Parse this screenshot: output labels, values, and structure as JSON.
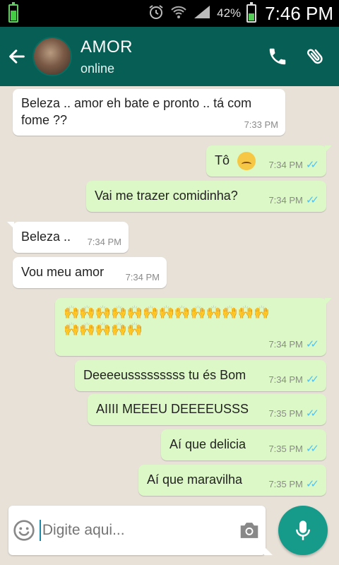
{
  "status_bar": {
    "battery_percent": "42%",
    "time": "7:46 PM",
    "icons": [
      "battery-icon",
      "alarm-icon",
      "wifi-icon",
      "signal-icon",
      "battery-charging-icon"
    ]
  },
  "header": {
    "contact_name": "AMOR",
    "contact_status": "online",
    "icons": [
      "back-arrow-icon",
      "avatar",
      "phone-icon",
      "paperclip-icon"
    ],
    "color": "#075e54"
  },
  "messages": [
    {
      "dir": "in",
      "text_line1": "Beleza .. amor eh bate e pronto .. tá com",
      "text_line2": "fome ??",
      "time": "7:33 PM"
    },
    {
      "dir": "out",
      "text": "Tô",
      "emoji": "worried-face-emoji",
      "time": "7:34 PM"
    },
    {
      "dir": "out",
      "text": "Vai me trazer comidinha?",
      "time": "7:34 PM"
    },
    {
      "dir": "in",
      "text": "Beleza ..",
      "time": "7:34 PM"
    },
    {
      "dir": "in",
      "text": "Vou meu amor",
      "time": "7:34 PM"
    },
    {
      "dir": "out",
      "text_line1": "🙌🙌🙌🙌🙌🙌🙌🙌🙌🙌🙌🙌🙌",
      "text_line2": "🙌🙌🙌🙌🙌",
      "emoji": "raising-hands-emoji",
      "time": "7:34 PM"
    },
    {
      "dir": "out",
      "text": "Deeeeusssssssss tu és Bom",
      "time": "7:34 PM"
    },
    {
      "dir": "out",
      "text": "AIIII MEEEU DEEEEUSSS",
      "time": "7:35 PM"
    },
    {
      "dir": "out",
      "text": "Aí que delicia",
      "time": "7:35 PM"
    },
    {
      "dir": "out",
      "text": "Aí que maravilha",
      "time": "7:35 PM"
    }
  ],
  "composer": {
    "placeholder": "Digite aqui...",
    "icons": [
      "emoji-icon",
      "camera-icon",
      "microphone-icon"
    ]
  },
  "colors": {
    "outgoing_bubble": "#dcf8c6",
    "incoming_bubble": "#ffffff",
    "read_ticks": "#4fc3f7",
    "mic_button": "#169b8b"
  }
}
